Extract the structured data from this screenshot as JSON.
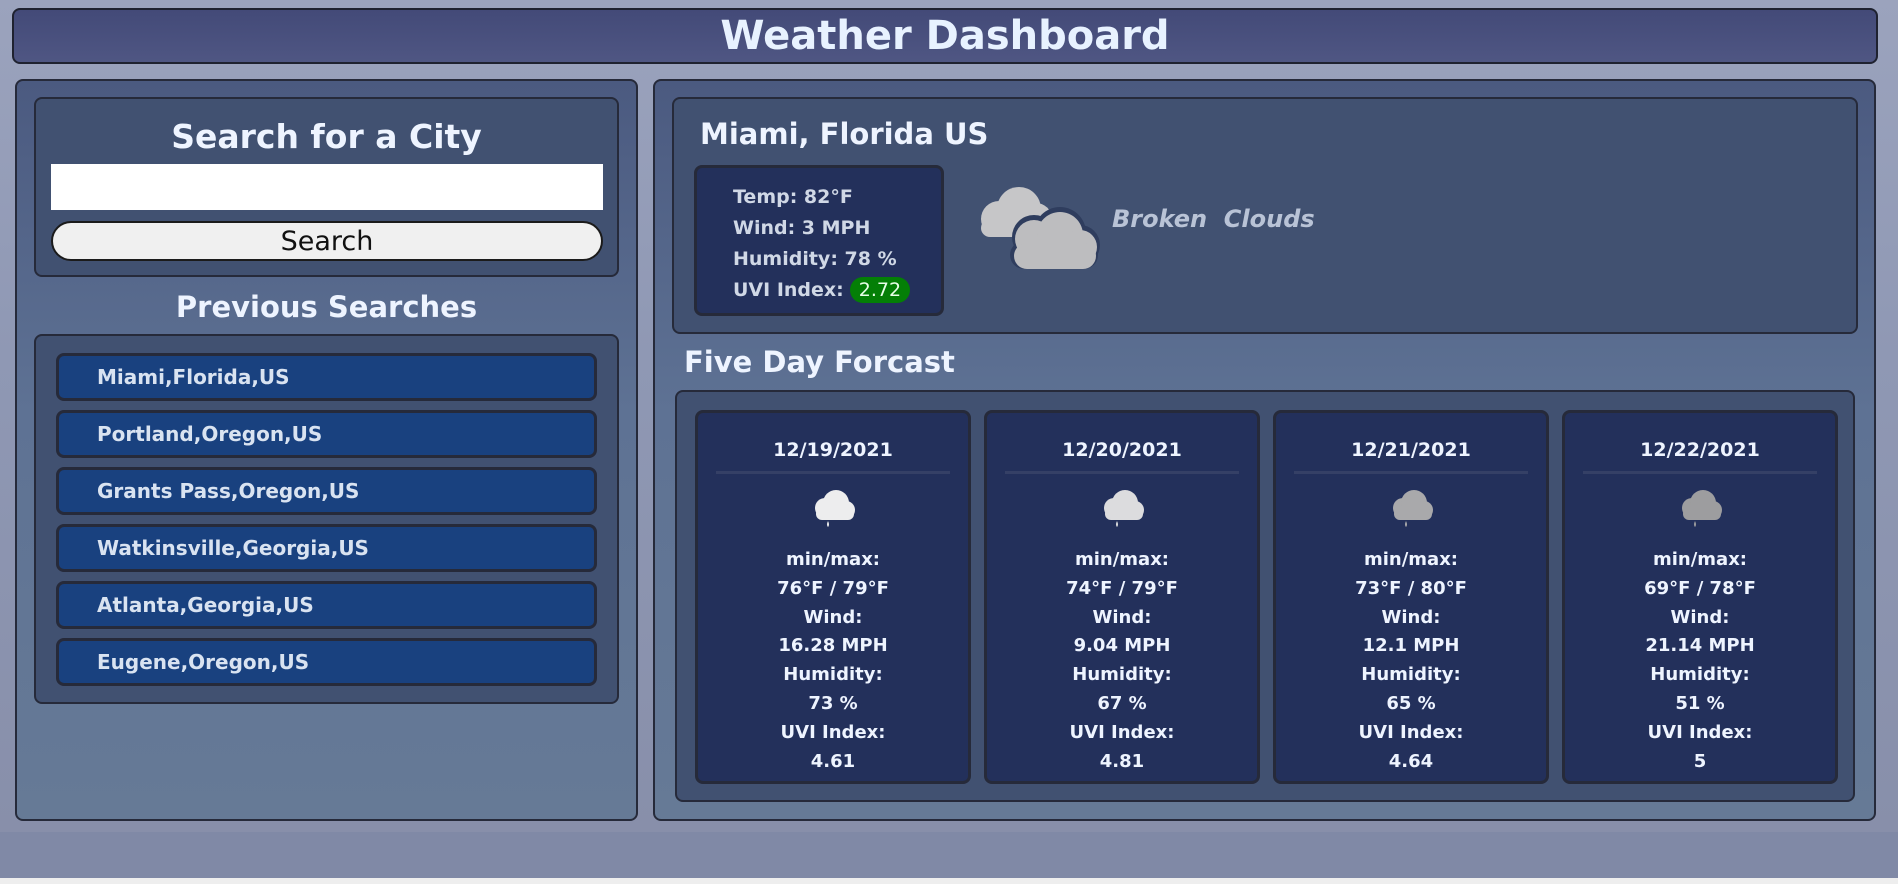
{
  "header": {
    "title": "Weather Dashboard"
  },
  "search": {
    "title": "Search for a City",
    "input_value": "",
    "placeholder": "",
    "button_label": "Search"
  },
  "history": {
    "title": "Previous Searches",
    "items": [
      "Miami,Florida,US",
      "Portland,Oregon,US",
      "Grants Pass,Oregon,US",
      "Watkinsville,Georgia,US",
      "Atlanta,Georgia,US",
      "Eugene,Oregon,US"
    ]
  },
  "current": {
    "city": "Miami, Florida US",
    "temp": "Temp: 82°F",
    "wind": "Wind: 3 MPH",
    "humidity": "Humidity: 78 %",
    "uvi_label": "UVI Index:",
    "uvi_value": "2.72",
    "uvi_color": "#047f06",
    "condition": "Broken  Clouds",
    "icon": "broken-clouds-icon"
  },
  "forecast": {
    "title": "Five Day Forcast",
    "min_max_label": "min/max:",
    "wind_label": "Wind:",
    "humidity_label": "Humidity:",
    "uvi_label": "UVI Index:",
    "days": [
      {
        "date": "12/19/2021",
        "minmax": "76°F / 79°F",
        "wind": "16.28 MPH",
        "humidity": "73 %",
        "uvi": "4.61",
        "icon": "rain-cloud-icon"
      },
      {
        "date": "12/20/2021",
        "minmax": "74°F / 79°F",
        "wind": "9.04 MPH",
        "humidity": "67 %",
        "uvi": "4.81",
        "icon": "rain-cloud-icon"
      },
      {
        "date": "12/21/2021",
        "minmax": "73°F / 80°F",
        "wind": "12.1 MPH",
        "humidity": "65 %",
        "uvi": "4.64",
        "icon": "rain-cloud-icon"
      },
      {
        "date": "12/22/2021",
        "minmax": "69°F / 78°F",
        "wind": "21.14 MPH",
        "humidity": "51 %",
        "uvi": "5",
        "icon": "rain-cloud-icon"
      }
    ]
  }
}
